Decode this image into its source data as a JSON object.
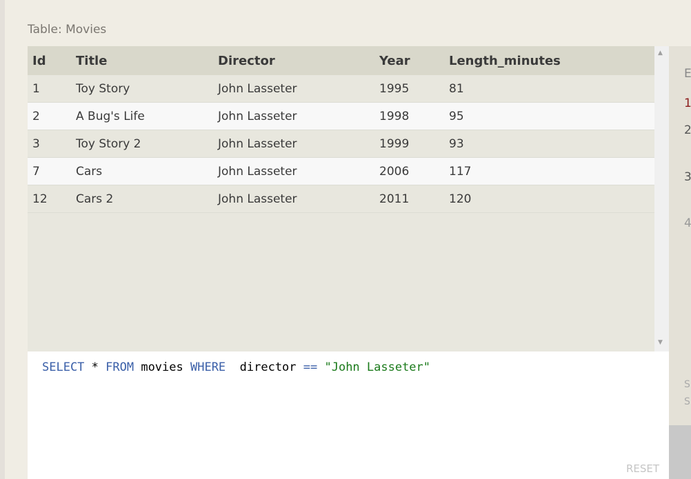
{
  "table_label": "Table: Movies",
  "columns": [
    "Id",
    "Title",
    "Director",
    "Year",
    "Length_minutes"
  ],
  "rows": [
    [
      "1",
      "Toy Story",
      "John Lasseter",
      "1995",
      "81"
    ],
    [
      "2",
      "A Bug's Life",
      "John Lasseter",
      "1998",
      "95"
    ],
    [
      "3",
      "Toy Story 2",
      "John Lasseter",
      "1999",
      "93"
    ],
    [
      "7",
      "Cars",
      "John Lasseter",
      "2006",
      "117"
    ],
    [
      "12",
      "Cars 2",
      "John Lasseter",
      "2011",
      "120"
    ]
  ],
  "query": {
    "select": "SELECT",
    "star": " * ",
    "from": "FROM",
    "table": " movies ",
    "where": "WHERE",
    "col": "  director ",
    "op": "==",
    "value": " \"John Lasseter\""
  },
  "reset_label": "RESET",
  "side_fragments": [
    "E",
    "1",
    "2",
    "3",
    "4",
    "S",
    "S"
  ],
  "colors": {
    "keyword": "#3a5fa8",
    "string": "#1a7a1a",
    "header_bg": "#d9d8cb"
  }
}
